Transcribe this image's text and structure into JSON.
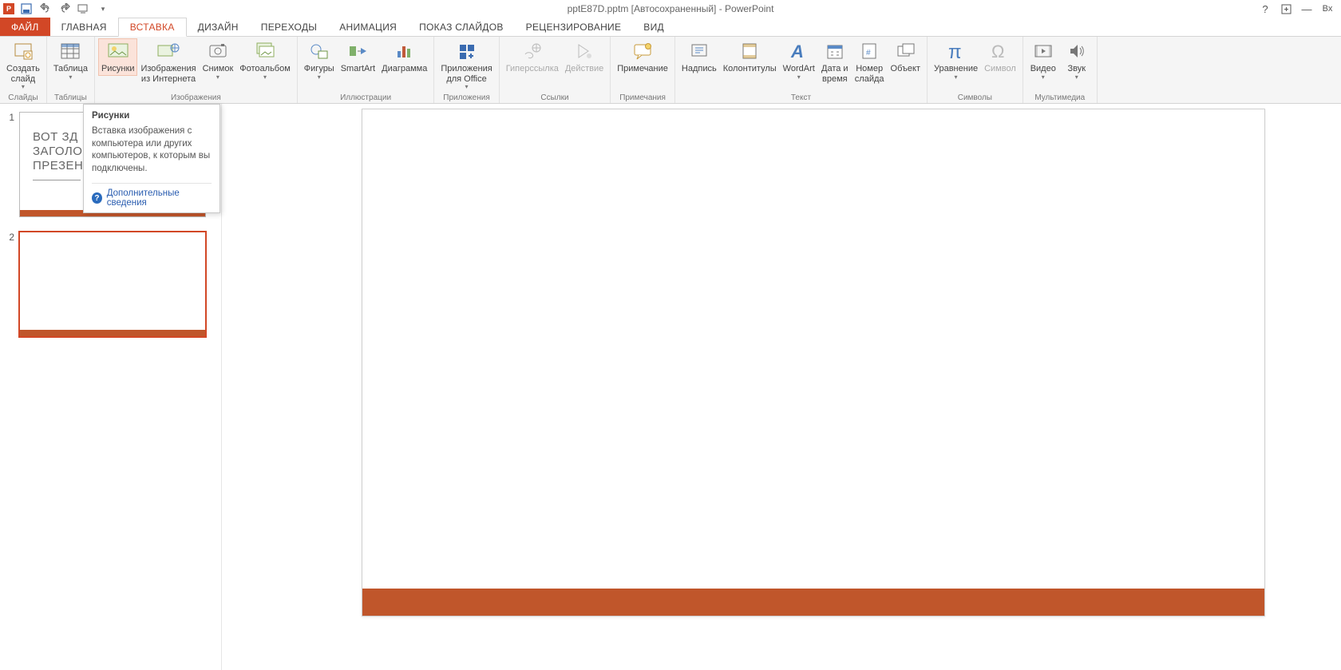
{
  "title": "pptE87D.pptm [Автосохраненный] - PowerPoint",
  "window": {
    "signin": "Вх"
  },
  "tabs": {
    "file": "ФАЙЛ",
    "home": "ГЛАВНАЯ",
    "insert": "ВСТАВКА",
    "design": "ДИЗАЙН",
    "transitions": "ПЕРЕХОДЫ",
    "animation": "АНИМАЦИЯ",
    "slideshow": "ПОКАЗ СЛАЙДОВ",
    "review": "РЕЦЕНЗИРОВАНИЕ",
    "view": "ВИД"
  },
  "ribbon": {
    "groups": {
      "slides": "Слайды",
      "tables": "Таблицы",
      "images": "Изображения",
      "illustrations": "Иллюстрации",
      "apps": "Приложения",
      "links": "Ссылки",
      "comments": "Примечания",
      "text": "Текст",
      "symbols": "Символы",
      "media": "Мультимедиа"
    },
    "cmds": {
      "new_slide": "Создать\nслайд",
      "table": "Таблица",
      "pictures": "Рисунки",
      "online_pictures": "Изображения\nиз Интернета",
      "screenshot": "Снимок",
      "photo_album": "Фотоальбом",
      "shapes": "Фигуры",
      "smartart": "SmartArt",
      "chart": "Диаграмма",
      "apps_office": "Приложения\nдля Office",
      "hyperlink": "Гиперссылка",
      "action": "Действие",
      "comment": "Примечание",
      "textbox": "Надпись",
      "header_footer": "Колонтитулы",
      "wordart": "WordArt",
      "datetime": "Дата и\nвремя",
      "slide_number": "Номер\nслайда",
      "object": "Объект",
      "equation": "Уравнение",
      "symbol": "Символ",
      "video": "Видео",
      "audio": "Звук"
    }
  },
  "tooltip": {
    "title": "Рисунки",
    "body": "Вставка изображения с компьютера или других компьютеров, к которым вы подключены.",
    "link": "Дополнительные сведения"
  },
  "thumbs": {
    "n1": "1",
    "n2": "2",
    "slide1_title": "ВОТ ЗД\nЗАГОЛО\nПРЕЗЕН"
  }
}
